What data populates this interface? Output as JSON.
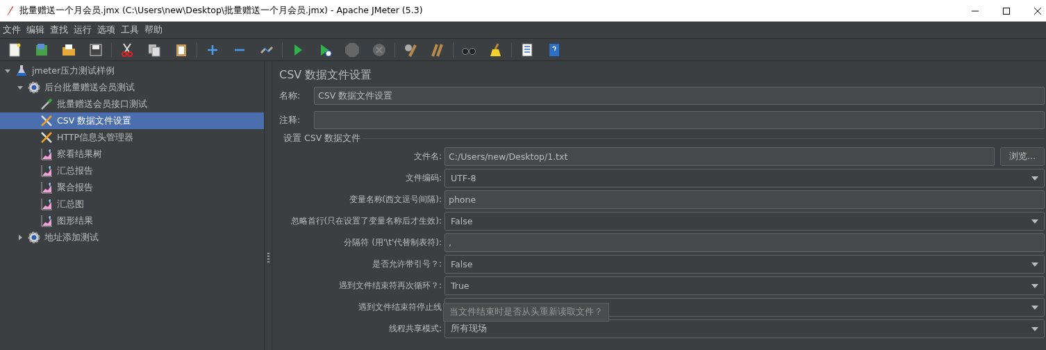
{
  "window": {
    "title": "批量赠送一个月会员.jmx (C:\\Users\\new\\Desktop\\批量赠送一个月会员.jmx) - Apache JMeter (5.3)"
  },
  "menu": [
    "文件",
    "编辑",
    "查找",
    "运行",
    "选项",
    "工具",
    "帮助"
  ],
  "tree": [
    {
      "label": "jmeter压力测试样例",
      "kind": "plan",
      "expanded": true,
      "selected": false,
      "children": [
        {
          "label": "后台批量赠送会员测试",
          "kind": "group",
          "expanded": true,
          "selected": false,
          "children": [
            {
              "label": "批量赠送会员接口测试",
              "kind": "sampler",
              "selected": false
            },
            {
              "label": "CSV 数据文件设置",
              "kind": "config",
              "selected": true
            },
            {
              "label": "HTTP信息头管理器",
              "kind": "config",
              "selected": false
            },
            {
              "label": "察看结果树",
              "kind": "listener",
              "selected": false
            },
            {
              "label": "汇总报告",
              "kind": "listener",
              "selected": false
            },
            {
              "label": "聚合报告",
              "kind": "listener",
              "selected": false
            },
            {
              "label": "汇总图",
              "kind": "listener",
              "selected": false
            },
            {
              "label": "图形结果",
              "kind": "listener",
              "selected": false
            }
          ]
        },
        {
          "label": "地址添加测试",
          "kind": "group",
          "expanded": false,
          "selected": false
        }
      ]
    }
  ],
  "panel": {
    "title": "CSV 数据文件设置",
    "name_label": "名称:",
    "name_value": "CSV 数据文件设置",
    "comment_label": "注释:",
    "group_title": "设置 CSV 数据文件",
    "fields": [
      {
        "label": "文件名:",
        "kind": "file",
        "value": "C:/Users/new/Desktop/1.txt",
        "button": "浏览..."
      },
      {
        "label": "文件编码:",
        "kind": "select",
        "value": "UTF-8"
      },
      {
        "label": "变量名称(西文逗号间隔):",
        "kind": "text",
        "value": "phone"
      },
      {
        "label": "忽略首行(只在设置了变量名称后才生效):",
        "kind": "select",
        "value": "False"
      },
      {
        "label": "分隔符 (用'\\t'代替制表符):",
        "kind": "text",
        "value": ","
      },
      {
        "label": "是否允许带引号？:",
        "kind": "select",
        "value": "False"
      },
      {
        "label": "遇到文件结束符再次循环？:",
        "kind": "select",
        "value": "True"
      },
      {
        "label": "遇到文件结束符停止线",
        "kind": "select"
      },
      {
        "label": "线程共享模式:",
        "kind": "select",
        "value": "所有现场"
      }
    ]
  },
  "tooltip": "当文件结束时是否从头重新读取文件？"
}
